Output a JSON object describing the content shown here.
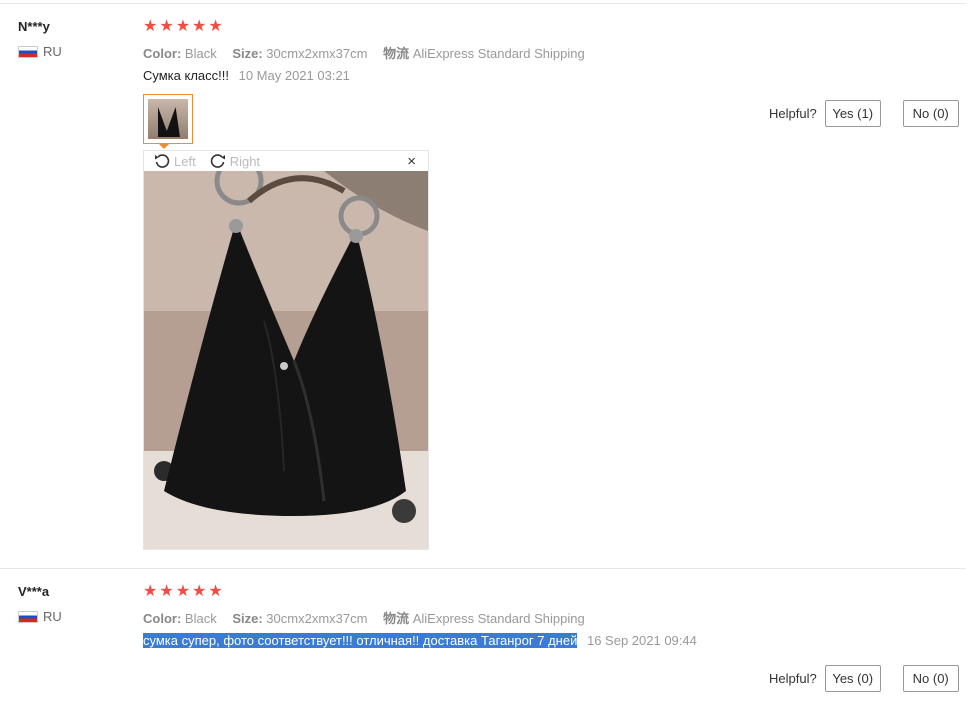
{
  "reviews": [
    {
      "user": "N***y",
      "country": "RU",
      "stars": [
        "★",
        "★",
        "★",
        "★",
        "★"
      ],
      "color_label": "Color:",
      "color_value": "Black",
      "size_label": "Size:",
      "size_value": "30cmx2xmx37cm",
      "ship_label": "物流",
      "ship_value": "AliExpress Standard Shipping",
      "text": "Сумка класс!!!",
      "date": "10 May 2021 03:21",
      "helpful_label": "Helpful?",
      "yes_label": "Yes (1)",
      "no_label": "No (0)"
    },
    {
      "user": "V***a",
      "country": "RU",
      "stars": [
        "★",
        "★",
        "★",
        "★",
        "★"
      ],
      "color_label": "Color:",
      "color_value": "Black",
      "size_label": "Size:",
      "size_value": "30cmx2xmx37cm",
      "ship_label": "物流",
      "ship_value": "AliExpress Standard Shipping",
      "text": "сумка супер, фото соответствует!!! отличная!! доставка Таганрог 7 дней",
      "date": "16 Sep 2021 09:44",
      "helpful_label": "Helpful?",
      "yes_label": "Yes (0)",
      "no_label": "No (0)"
    }
  ],
  "viewer": {
    "left_label": "Left",
    "right_label": "Right",
    "close_symbol": "×"
  },
  "colors": {
    "star": "#f04e45",
    "thumb_border": "#f08b36",
    "selection": "#3a7bd5"
  }
}
